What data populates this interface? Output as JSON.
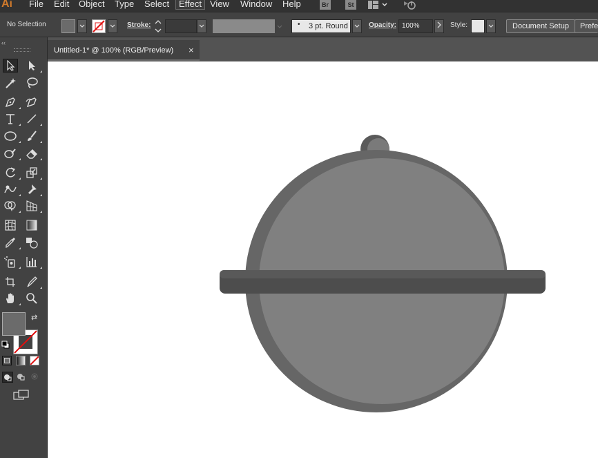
{
  "app": {
    "logo": "Ai"
  },
  "menu": {
    "items": [
      "File",
      "Edit",
      "Object",
      "Type",
      "Select",
      "Effect",
      "View",
      "Window",
      "Help"
    ],
    "active": "Effect",
    "bridge_label": "Br",
    "stock_label": "St"
  },
  "controlbar": {
    "selection_status": "No Selection",
    "stroke_label": "Stroke:",
    "brush_value": "3 pt. Round",
    "opacity_label": "Opacity:",
    "opacity_value": "100%",
    "style_label": "Style:",
    "document_setup_label": "Document Setup",
    "preferences_label": "Prefer"
  },
  "document_tab": {
    "title": "Untitled-1* @ 100% (RGB/Preview)",
    "close_glyph": "×"
  },
  "tools": [
    "selection-tool",
    "direct-selection-tool",
    "magic-wand-tool",
    "lasso-tool",
    "pen-tool",
    "curvature-tool",
    "type-tool",
    "line-segment-tool",
    "ellipse-tool",
    "paintbrush-tool",
    "shaper-tool",
    "eraser-tool",
    "rotate-tool",
    "scale-tool",
    "warp-tool",
    "puppet-warp-tool",
    "shape-builder-tool",
    "perspective-grid-tool",
    "mesh-tool",
    "gradient-tool",
    "eyedropper-tool",
    "blend-tool",
    "symbol-sprayer-tool",
    "column-graph-tool",
    "artboard-tool",
    "slice-tool",
    "hand-tool",
    "zoom-tool"
  ],
  "colors": {
    "fill": "#6b6b6b",
    "stroke": "none",
    "artwork_main": "#808080",
    "artwork_shadow": "#666666",
    "artwork_band": "#4d4d4d",
    "artwork_band_top": "#595959"
  }
}
